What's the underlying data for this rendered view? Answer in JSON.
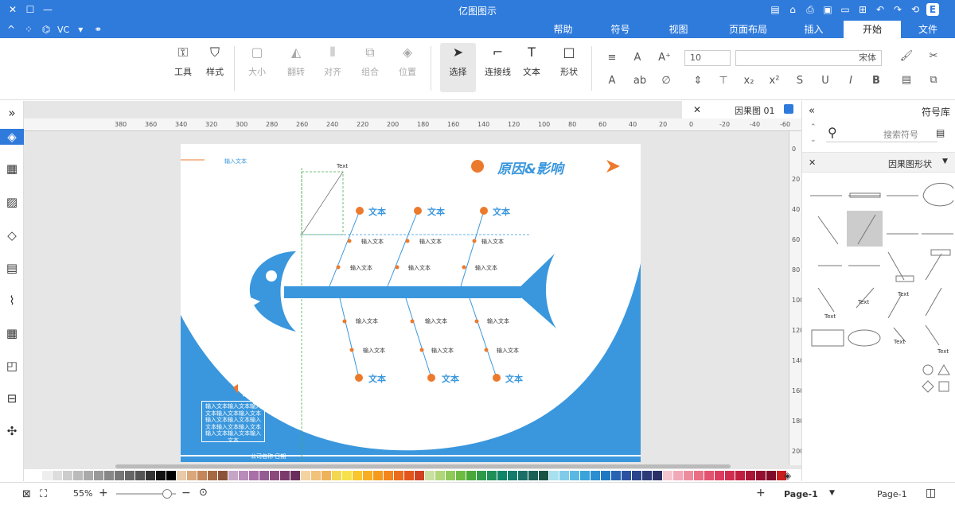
{
  "window": {
    "title": "亿图图示"
  },
  "tabs": [
    {
      "label": "文件"
    },
    {
      "label": "开始"
    },
    {
      "label": "插入"
    },
    {
      "label": "页面布局"
    },
    {
      "label": "视图"
    },
    {
      "label": "符号"
    },
    {
      "label": "帮助"
    }
  ],
  "quick_left": {
    "vc": "VC"
  },
  "ribbon": {
    "tools": "工具",
    "style": "样式",
    "size": "大小",
    "rotate": "翻转",
    "align": "对齐",
    "group": "组合",
    "position": "位置",
    "select": "选择",
    "connector": "连接线",
    "text": "文本",
    "shape": "形状",
    "font_size": "10",
    "font_name": "宋体"
  },
  "document": {
    "tab_label": "因果图 01"
  },
  "ruler_h": [
    "-60",
    "-40",
    "-20",
    "0",
    "20",
    "40",
    "60",
    "80",
    "100",
    "120",
    "140",
    "160",
    "180",
    "200",
    "220",
    "240",
    "260",
    "280",
    "300",
    "320",
    "340",
    "360",
    "380"
  ],
  "ruler_v": [
    "0",
    "20",
    "40",
    "60",
    "80",
    "100",
    "120",
    "140",
    "160",
    "180",
    "200"
  ],
  "diagram": {
    "title": "原因&影响",
    "corner_text": "输入文本",
    "head_label": "Text",
    "upper_labels": [
      "文本",
      "文本",
      "文本"
    ],
    "lower_labels": [
      "文本",
      "文本",
      "文本"
    ],
    "input_text": "输入文本",
    "note_title": "文本",
    "note_body": "输入文本输入文本输入文本输入文本输入文本输入文本输入文本输入文本输入文本输入文本输入文本输入文本输入文本",
    "footer": "公司名称·日期"
  },
  "symbol_panel": {
    "title": "符号库",
    "search_placeholder": "搜索符号",
    "category": "因果图形状",
    "shape_labels": [
      "Text",
      "Text",
      "Text",
      "Text",
      "Text"
    ]
  },
  "status": {
    "page_select": "Page-1",
    "page_tab": "Page-1",
    "zoom": "55%"
  },
  "colors": {
    "accent": "#2f7bdc",
    "diagram_blue": "#3a97dd",
    "orange": "#ec7a2c"
  }
}
